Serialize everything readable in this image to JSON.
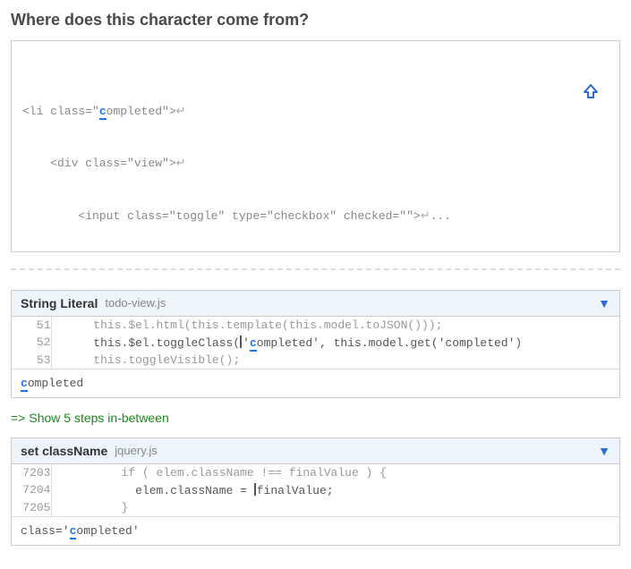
{
  "title": "Where does this character come from?",
  "question": {
    "line1_pre": "<li class=\"",
    "line1_hl": "c",
    "line1_post": "ompleted\">",
    "line2": "    <div class=\"view\">",
    "line3": "        <input class=\"toggle\" type=\"checkbox\" checked=\"\">",
    "ellipsis": "...",
    "return_symbol": "↵"
  },
  "show_steps": {
    "arrow": "=>",
    "text": "Show 5 steps in-between"
  },
  "panels": [
    {
      "title": "String Literal",
      "file": "todo-view.js",
      "lines": [
        {
          "n": "51",
          "code": "      this.$el.html(this.template(this.model.toJSON()));",
          "active": false,
          "cursor": false
        },
        {
          "n": "52",
          "pre": "      this.$el.toggleClass(",
          "post": "'",
          "hl": "c",
          "tail": "ompleted', this.model.get('completed')",
          "active": true,
          "cursor": true
        },
        {
          "n": "53",
          "code": "      this.toggleVisible();",
          "active": false,
          "cursor": false
        }
      ],
      "footer_hl": "c",
      "footer_tail": "ompleted"
    },
    {
      "title": "set className",
      "file": "jquery.js",
      "lines": [
        {
          "n": "7203",
          "code": "          if ( elem.className !== finalValue ) {",
          "active": false,
          "cursor": false
        },
        {
          "n": "7204",
          "pre": "            elem.className = ",
          "post": "finalValue;",
          "active": true,
          "cursor": true
        },
        {
          "n": "7205",
          "code": "          }",
          "active": false,
          "cursor": false
        }
      ],
      "footer_pre": "class='",
      "footer_hl": "c",
      "footer_tail": "ompleted'"
    }
  ],
  "glyphs": {
    "triangle_down": "▼"
  }
}
